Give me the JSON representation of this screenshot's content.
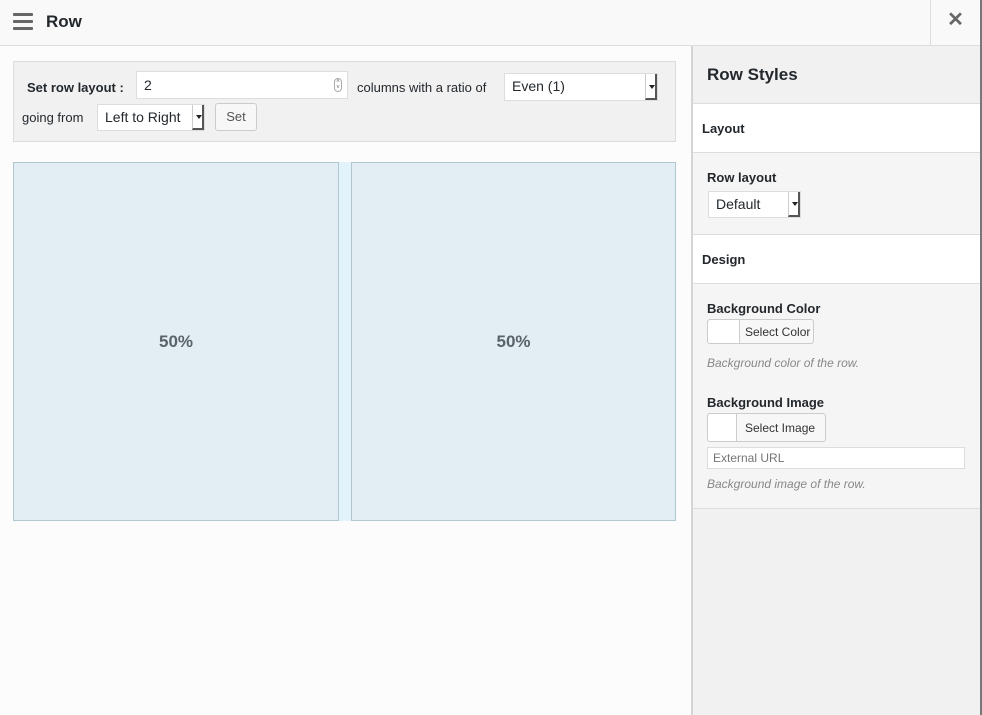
{
  "header": {
    "title": "Row",
    "menu_icon": "hamburger-menu-icon",
    "close_icon": "close-icon",
    "close_glyph": "✕"
  },
  "toolbar": {
    "set_row_layout_label": "Set row layout :",
    "columns_value": "2",
    "columns_suffix": "columns with a ratio of",
    "ratio_selected": "Even (1)",
    "going_from_label": "going from",
    "direction_selected": "Left to Right",
    "set_button": "Set"
  },
  "columns": [
    {
      "label": "50%",
      "width_percent": 50
    },
    {
      "label": "50%",
      "width_percent": 50
    }
  ],
  "sidebar": {
    "title": "Row Styles",
    "sections": {
      "layout": {
        "heading": "Layout",
        "row_layout_label": "Row layout",
        "row_layout_selected": "Default"
      },
      "design": {
        "heading": "Design",
        "bg_color_label": "Background Color",
        "select_color_button": "Select Color",
        "bg_color_desc": "Background color of the row.",
        "bg_image_label": "Background Image",
        "select_image_button": "Select Image",
        "external_url_placeholder": "External URL",
        "bg_image_desc": "Background image of the row."
      }
    }
  }
}
